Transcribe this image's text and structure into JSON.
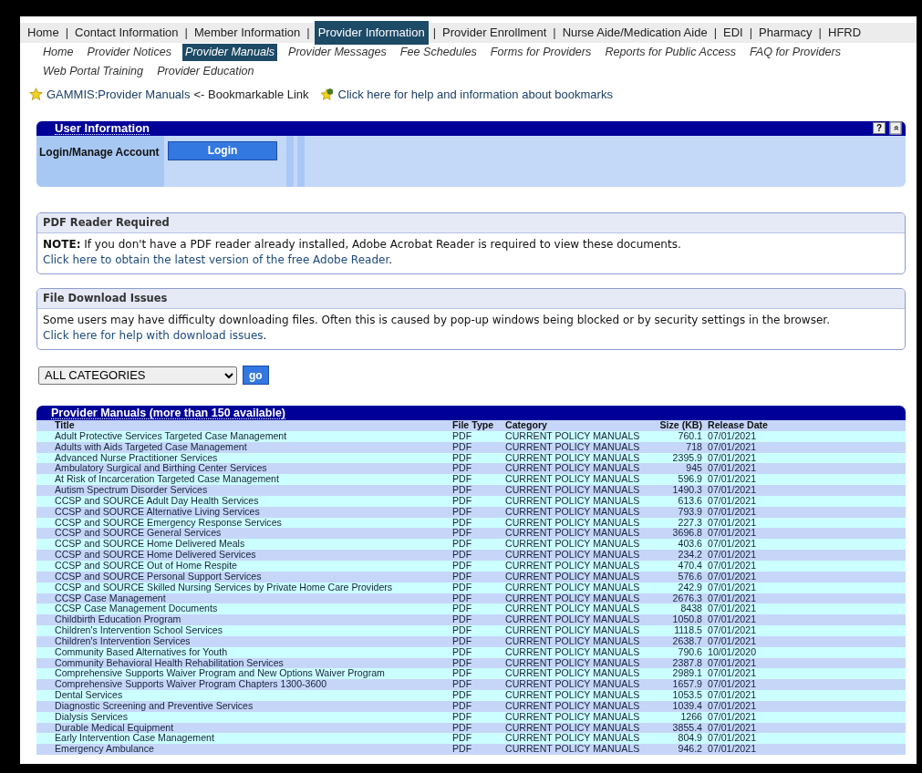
{
  "top_nav": {
    "separator": "|",
    "items": [
      {
        "label": "Home",
        "selected": false
      },
      {
        "label": "Contact Information",
        "selected": false
      },
      {
        "label": "Member Information",
        "selected": false
      },
      {
        "label": "Provider Information",
        "selected": true
      },
      {
        "label": "Provider Enrollment",
        "selected": false
      },
      {
        "label": "Nurse Aide/Medication Aide",
        "selected": false
      },
      {
        "label": "EDI",
        "selected": false
      },
      {
        "label": "Pharmacy",
        "selected": false
      },
      {
        "label": "HFRD",
        "selected": false
      }
    ]
  },
  "sub_nav": [
    {
      "label": "Home",
      "selected": false
    },
    {
      "label": "Provider Notices",
      "selected": false
    },
    {
      "label": "Provider Manuals",
      "selected": true
    },
    {
      "label": "Provider Messages",
      "selected": false
    },
    {
      "label": "Fee Schedules",
      "selected": false
    },
    {
      "label": "Forms for Providers",
      "selected": false
    },
    {
      "label": "Reports for Public Access",
      "selected": false
    },
    {
      "label": "FAQ for Providers",
      "selected": false
    },
    {
      "label": "Web Portal Training",
      "selected": false
    },
    {
      "label": "Provider Education",
      "selected": false
    }
  ],
  "bookmark": {
    "link": "GAMMIS:Provider Manuals",
    "note": "<- Bookmarkable Link",
    "help_link": "Click here for help and information about bookmarks"
  },
  "user_info": {
    "title": "User Information",
    "help": "?",
    "collapse": "»",
    "label": "Login/Manage Account",
    "button": "Login"
  },
  "pdf_panel": {
    "title": "PDF Reader Required",
    "note_label": "NOTE:",
    "text": "If you don't have a PDF reader already installed, Adobe Acrobat Reader is required to view these documents.",
    "link": [
      "Click here to obtain the latest version of the free",
      "Adobe Reader"
    ],
    "end": "."
  },
  "download_panel": {
    "title": "File Download Issues",
    "text": "Some users may have difficulty downloading files. Often this is caused by pop-up windows being blocked or by security settings in the browser.",
    "link": [
      "Click here for help",
      "with download issues"
    ],
    "end": "."
  },
  "filter": {
    "value": "ALL CATEGORIES",
    "button": "go"
  },
  "table": {
    "title": "Provider Manuals (more than 150 available)",
    "columns": [
      "Title",
      "File Type",
      "Category",
      "Size (KB)",
      "Release Date"
    ],
    "rows": [
      [
        "Adult Protective Services Targeted Case Management",
        "PDF",
        "CURRENT POLICY MANUALS",
        "760.1",
        "07/01/2021"
      ],
      [
        "Adults with Aids Targeted Case Management",
        "PDF",
        "CURRENT POLICY MANUALS",
        "718",
        "07/01/2021"
      ],
      [
        "Advanced Nurse Practitioner Services",
        "PDF",
        "CURRENT POLICY MANUALS",
        "2395.9",
        "07/01/2021"
      ],
      [
        "Ambulatory Surgical and Birthing Center Services",
        "PDF",
        "CURRENT POLICY MANUALS",
        "945",
        "07/01/2021"
      ],
      [
        "At Risk of Incarceration Targeted Case Management",
        "PDF",
        "CURRENT POLICY MANUALS",
        "596.9",
        "07/01/2021"
      ],
      [
        "Autism Spectrum Disorder Services",
        "PDF",
        "CURRENT POLICY MANUALS",
        "1490.3",
        "07/01/2021"
      ],
      [
        "CCSP and SOURCE Adult Day Health Services",
        "PDF",
        "CURRENT POLICY MANUALS",
        "613.6",
        "07/01/2021"
      ],
      [
        "CCSP and SOURCE Alternative Living Services",
        "PDF",
        "CURRENT POLICY MANUALS",
        "793.9",
        "07/01/2021"
      ],
      [
        "CCSP and SOURCE Emergency Response Services",
        "PDF",
        "CURRENT POLICY MANUALS",
        "227.3",
        "07/01/2021"
      ],
      [
        "CCSP and SOURCE General Services",
        "PDF",
        "CURRENT POLICY MANUALS",
        "3696.8",
        "07/01/2021"
      ],
      [
        "CCSP and SOURCE Home Delivered Meals",
        "PDF",
        "CURRENT POLICY MANUALS",
        "403.6",
        "07/01/2021"
      ],
      [
        "CCSP and SOURCE Home Delivered Services",
        "PDF",
        "CURRENT POLICY MANUALS",
        "234.2",
        "07/01/2021"
      ],
      [
        "CCSP and SOURCE Out of Home Respite",
        "PDF",
        "CURRENT POLICY MANUALS",
        "470.4",
        "07/01/2021"
      ],
      [
        "CCSP and SOURCE Personal Support Services",
        "PDF",
        "CURRENT POLICY MANUALS",
        "576.6",
        "07/01/2021"
      ],
      [
        "CCSP and SOURCE Skilled Nursing Services by Private Home Care Providers",
        "PDF",
        "CURRENT POLICY MANUALS",
        "242.9",
        "07/01/2021"
      ],
      [
        "CCSP Case Management",
        "PDF",
        "CURRENT POLICY MANUALS",
        "2676.3",
        "07/01/2021"
      ],
      [
        "CCSP Case Management Documents",
        "PDF",
        "CURRENT POLICY MANUALS",
        "8438",
        "07/01/2021"
      ],
      [
        "Childbirth Education Program",
        "PDF",
        "CURRENT POLICY MANUALS",
        "1050.8",
        "07/01/2021"
      ],
      [
        "Children's Intervention School Services",
        "PDF",
        "CURRENT POLICY MANUALS",
        "1118.5",
        "07/01/2021"
      ],
      [
        "Children's Intervention Services",
        "PDF",
        "CURRENT POLICY MANUALS",
        "2638.7",
        "07/01/2021"
      ],
      [
        "Community Based Alternatives for Youth",
        "PDF",
        "CURRENT POLICY MANUALS",
        "790.6",
        "10/01/2020"
      ],
      [
        "Community Behavioral Health Rehabilitation Services",
        "PDF",
        "CURRENT POLICY MANUALS",
        "2387.8",
        "07/01/2021"
      ],
      [
        "Comprehensive Supports Waiver Program and New Options Waiver Program",
        "PDF",
        "CURRENT POLICY MANUALS",
        "2989.1",
        "07/01/2021"
      ],
      [
        "Comprehensive Supports Waiver Program Chapters 1300-3600",
        "PDF",
        "CURRENT POLICY MANUALS",
        "1657.9",
        "07/01/2021"
      ],
      [
        "Dental Services",
        "PDF",
        "CURRENT POLICY MANUALS",
        "1053.5",
        "07/01/2021"
      ],
      [
        "Diagnostic Screening and Preventive Services",
        "PDF",
        "CURRENT POLICY MANUALS",
        "1039.4",
        "07/01/2021"
      ],
      [
        "Dialysis Services",
        "PDF",
        "CURRENT POLICY MANUALS",
        "1266",
        "07/01/2021"
      ],
      [
        "Durable Medical Equipment",
        "PDF",
        "CURRENT POLICY MANUALS",
        "3855.4",
        "07/01/2021"
      ],
      [
        "Early Intervention Case Management",
        "PDF",
        "CURRENT POLICY MANUALS",
        "804.9",
        "07/01/2021"
      ],
      [
        "Emergency Ambulance",
        "PDF",
        "CURRENT POLICY MANUALS",
        "946.2",
        "07/01/2021"
      ]
    ]
  }
}
